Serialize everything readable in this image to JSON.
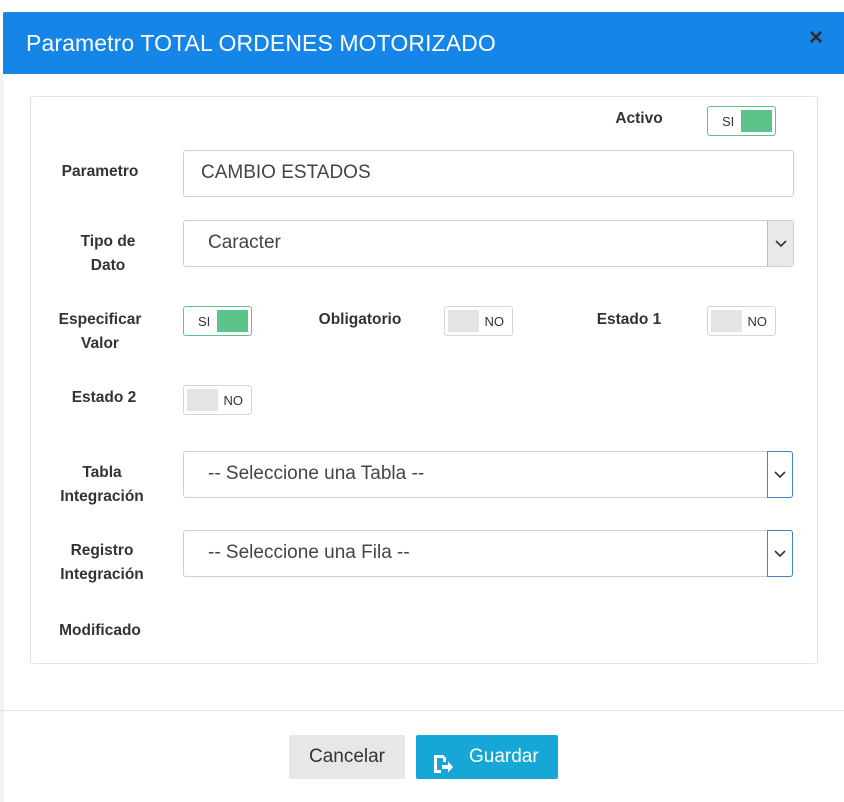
{
  "dialog": {
    "title": "Parametro TOTAL ORDENES MOTORIZADO",
    "close_glyph": "×"
  },
  "fields": {
    "activo": {
      "label": "Activo",
      "toggle": "SI"
    },
    "parametro": {
      "label": "Parametro",
      "value": "CAMBIO ESTADOS"
    },
    "tipo_dato": {
      "label_line1": "Tipo de",
      "label_line2": "Dato",
      "value": "Caracter"
    },
    "especificar_valor": {
      "label_line1": "Especificar",
      "label_line2": "Valor",
      "toggle": "SI"
    },
    "obligatorio": {
      "label": "Obligatorio",
      "toggle": "NO"
    },
    "estado1": {
      "label": "Estado 1",
      "toggle": "NO"
    },
    "estado2": {
      "label": "Estado 2",
      "toggle": "NO"
    },
    "tabla_integracion": {
      "label_line1": "Tabla",
      "label_line2": "Integración",
      "value": "-- Seleccione una Tabla --"
    },
    "registro_integracion": {
      "label_line1": "Registro",
      "label_line2": "Integración",
      "value": "-- Seleccione una Fila --"
    },
    "modificado": {
      "label": "Modificado"
    }
  },
  "footer": {
    "cancel_label": "Cancelar",
    "save_label": "Guardar",
    "save_icon": "save-arrow-icon"
  },
  "colors": {
    "header": "#1585e8",
    "toggle_on": "#5cc48a",
    "save_button": "#17a7d6"
  }
}
